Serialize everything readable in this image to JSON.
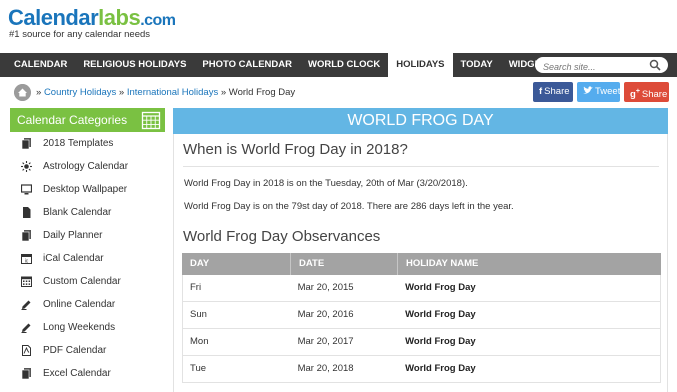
{
  "header": {
    "logo": {
      "part1": "Calendar",
      "part2": "labs",
      "part3": ".com"
    },
    "tagline": "#1 source for any calendar needs"
  },
  "nav": {
    "items": [
      {
        "label": "CALENDAR",
        "active": false
      },
      {
        "label": "RELIGIOUS HOLIDAYS",
        "active": false
      },
      {
        "label": "PHOTO CALENDAR",
        "active": false
      },
      {
        "label": "WORLD CLOCK",
        "active": false
      },
      {
        "label": "HOLIDAYS",
        "active": true
      },
      {
        "label": "TODAY",
        "active": false
      },
      {
        "label": "WIDGETS",
        "active": false
      }
    ],
    "search_placeholder": "Search site..."
  },
  "breadcrumb": {
    "items": [
      "Country Holidays",
      "International Holidays",
      "World Frog Day"
    ],
    "separator": "»"
  },
  "share": {
    "facebook": "Share",
    "twitter": "Tweet",
    "google": "Share"
  },
  "sidebar": {
    "title": "Calendar Categories",
    "items": [
      {
        "label": "2018 Templates",
        "icon": "document-stack-icon"
      },
      {
        "label": "Astrology Calendar",
        "icon": "sun-icon"
      },
      {
        "label": "Desktop Wallpaper",
        "icon": "monitor-icon"
      },
      {
        "label": "Blank Calendar",
        "icon": "document-icon"
      },
      {
        "label": "Daily Planner",
        "icon": "document-stack-icon"
      },
      {
        "label": "iCal Calendar",
        "icon": "ical-icon"
      },
      {
        "label": "Custom Calendar",
        "icon": "grid-calendar-icon"
      },
      {
        "label": "Online Calendar",
        "icon": "edit-icon"
      },
      {
        "label": "Long Weekends",
        "icon": "edit-icon"
      },
      {
        "label": "PDF Calendar",
        "icon": "pdf-icon"
      },
      {
        "label": "Excel Calendar",
        "icon": "document-stack-icon"
      }
    ]
  },
  "main": {
    "banner": "WORLD FROG DAY",
    "heading_when": "When is World Frog Day in 2018?",
    "paragraph1": "World Frog Day in 2018 is on the Tuesday, 20th of Mar (3/20/2018).",
    "paragraph2": "World Frog Day is on the 79st day of 2018. There are 286 days left in the year.",
    "heading_observances": "World Frog Day Observances",
    "table": {
      "headers": [
        "DAY",
        "DATE",
        "HOLIDAY NAME"
      ],
      "rows": [
        [
          "Fri",
          "Mar 20, 2015",
          "World Frog Day"
        ],
        [
          "Sun",
          "Mar 20, 2016",
          "World Frog Day"
        ],
        [
          "Mon",
          "Mar 20, 2017",
          "World Frog Day"
        ],
        [
          "Tue",
          "Mar 20, 2018",
          "World Frog Day"
        ]
      ]
    }
  },
  "colors": {
    "nav_bg": "#3a3a3a",
    "sidebar_header": "#7ac142",
    "banner": "#63b6e4",
    "link": "#1a75bb",
    "table_header": "#a3a3a3",
    "facebook": "#3b5998",
    "twitter": "#55acee",
    "google": "#dd4b39"
  }
}
